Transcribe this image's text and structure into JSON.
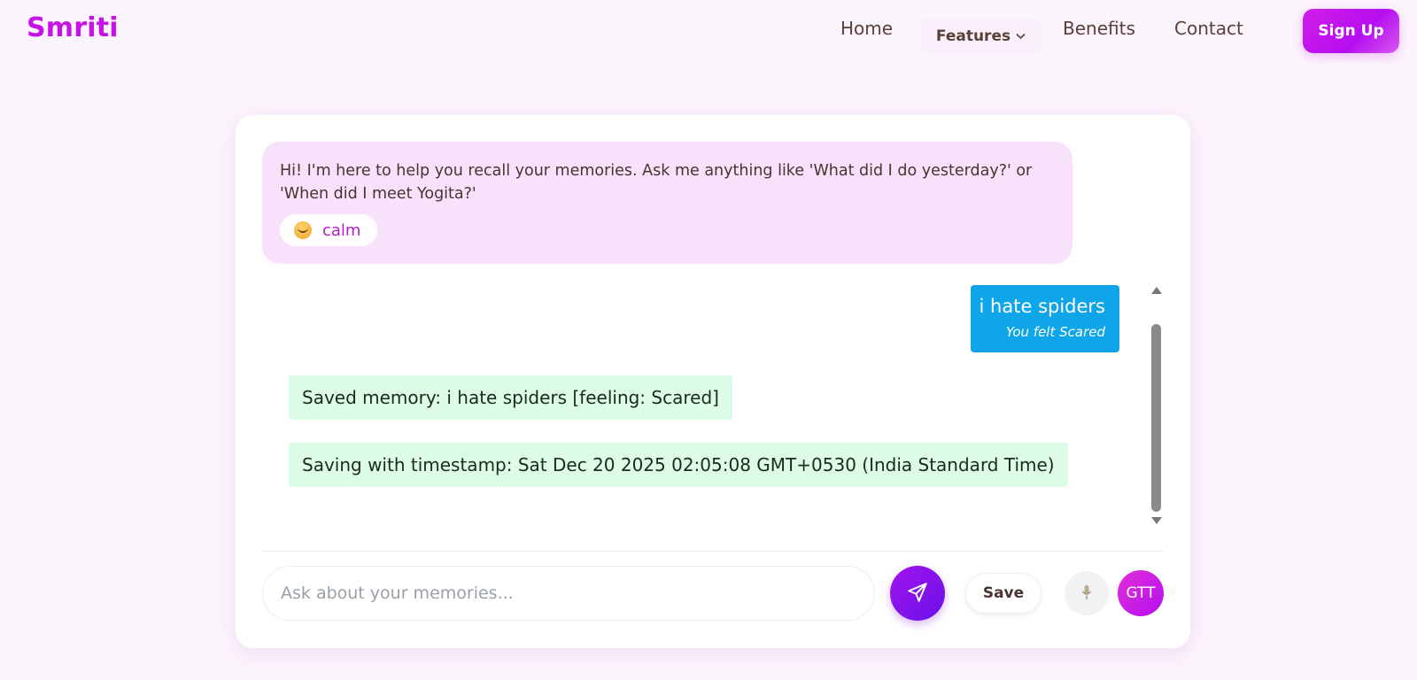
{
  "nav": {
    "logo": "Smriti",
    "links": {
      "home": "Home",
      "features": "Features",
      "benefits": "Benefits",
      "contact": "Contact"
    },
    "signup_label": "Sign Up"
  },
  "chat": {
    "greeting": "Hi! I'm here to help you recall your memories. Ask me anything like 'What did I do yesterday?' or 'When did I meet Yogita?'",
    "mood": {
      "icon": "smiling-face-icon",
      "label": "calm"
    },
    "user_message": {
      "text": "i hate spiders",
      "feeling": "You felt Scared"
    },
    "system_messages": [
      "Saved memory: i hate spiders [feeling: Scared]",
      "Saving with timestamp: Sat Dec 20 2025 02:05:08 GMT+0530 (India Standard Time)"
    ]
  },
  "composer": {
    "placeholder": "Ask about your memories...",
    "value": "",
    "send_icon": "send-icon",
    "save_label": "Save",
    "mic_icon": "microphone-icon",
    "gtt_label": "GTT"
  },
  "colors": {
    "brand": "#c613e6",
    "user_bubble": "#0ea5e9",
    "bot_bubble": "#f8e2fb",
    "system_bubble": "#dcfce7"
  }
}
